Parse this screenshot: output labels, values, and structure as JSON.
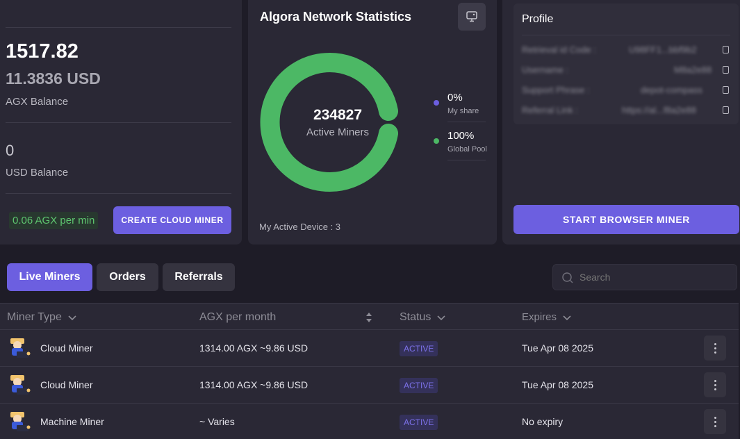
{
  "balance": {
    "agx_amount": "1517.82",
    "usd_equiv": "11.3836 USD",
    "agx_label": "AGX Balance",
    "usd_amount": "0",
    "usd_label": "USD Balance",
    "rate": "0.06 AGX per min",
    "create_button": "CREATE CLOUD MINER"
  },
  "stats": {
    "title": "Algora Network Statistics",
    "center_value": "234827",
    "center_label": "Active Miners",
    "legend": [
      {
        "value": "0%",
        "label": "My share",
        "color": "#6c5fe0"
      },
      {
        "value": "100%",
        "label": "Global Pool",
        "color": "#4cb865"
      }
    ],
    "donut_share": {
      "my_share": 0,
      "global_pool": 100
    },
    "active_device": "My Active Device : 3",
    "monitor_icon": "monitor-icon"
  },
  "profile": {
    "title": "Profile",
    "rows": [
      {
        "label": "Retrieval id Code :",
        "value": "U98FF1...bbf9b2"
      },
      {
        "label": "Username :",
        "value": "M8a2e88"
      },
      {
        "label": "Support Phrase :",
        "value": "depot-compass"
      },
      {
        "label": "Referral Link :",
        "value": "https://al...f8a2e88"
      }
    ],
    "start_button": "START BROWSER MINER"
  },
  "tabs": [
    {
      "label": "Live Miners",
      "active": true
    },
    {
      "label": "Orders",
      "active": false
    },
    {
      "label": "Referrals",
      "active": false
    }
  ],
  "search": {
    "placeholder": "Search"
  },
  "table": {
    "columns": [
      "Miner Type",
      "AGX per month",
      "Status",
      "Expires"
    ],
    "rows": [
      {
        "type": "Cloud Miner",
        "agx": "1314.00 AGX ~9.86 USD",
        "status": "ACTIVE",
        "expires": "Tue Apr 08 2025"
      },
      {
        "type": "Cloud Miner",
        "agx": "1314.00 AGX ~9.86 USD",
        "status": "ACTIVE",
        "expires": "Tue Apr 08 2025"
      },
      {
        "type": "Machine Miner",
        "agx": "~ Varies",
        "status": "ACTIVE",
        "expires": "No expiry"
      }
    ]
  }
}
